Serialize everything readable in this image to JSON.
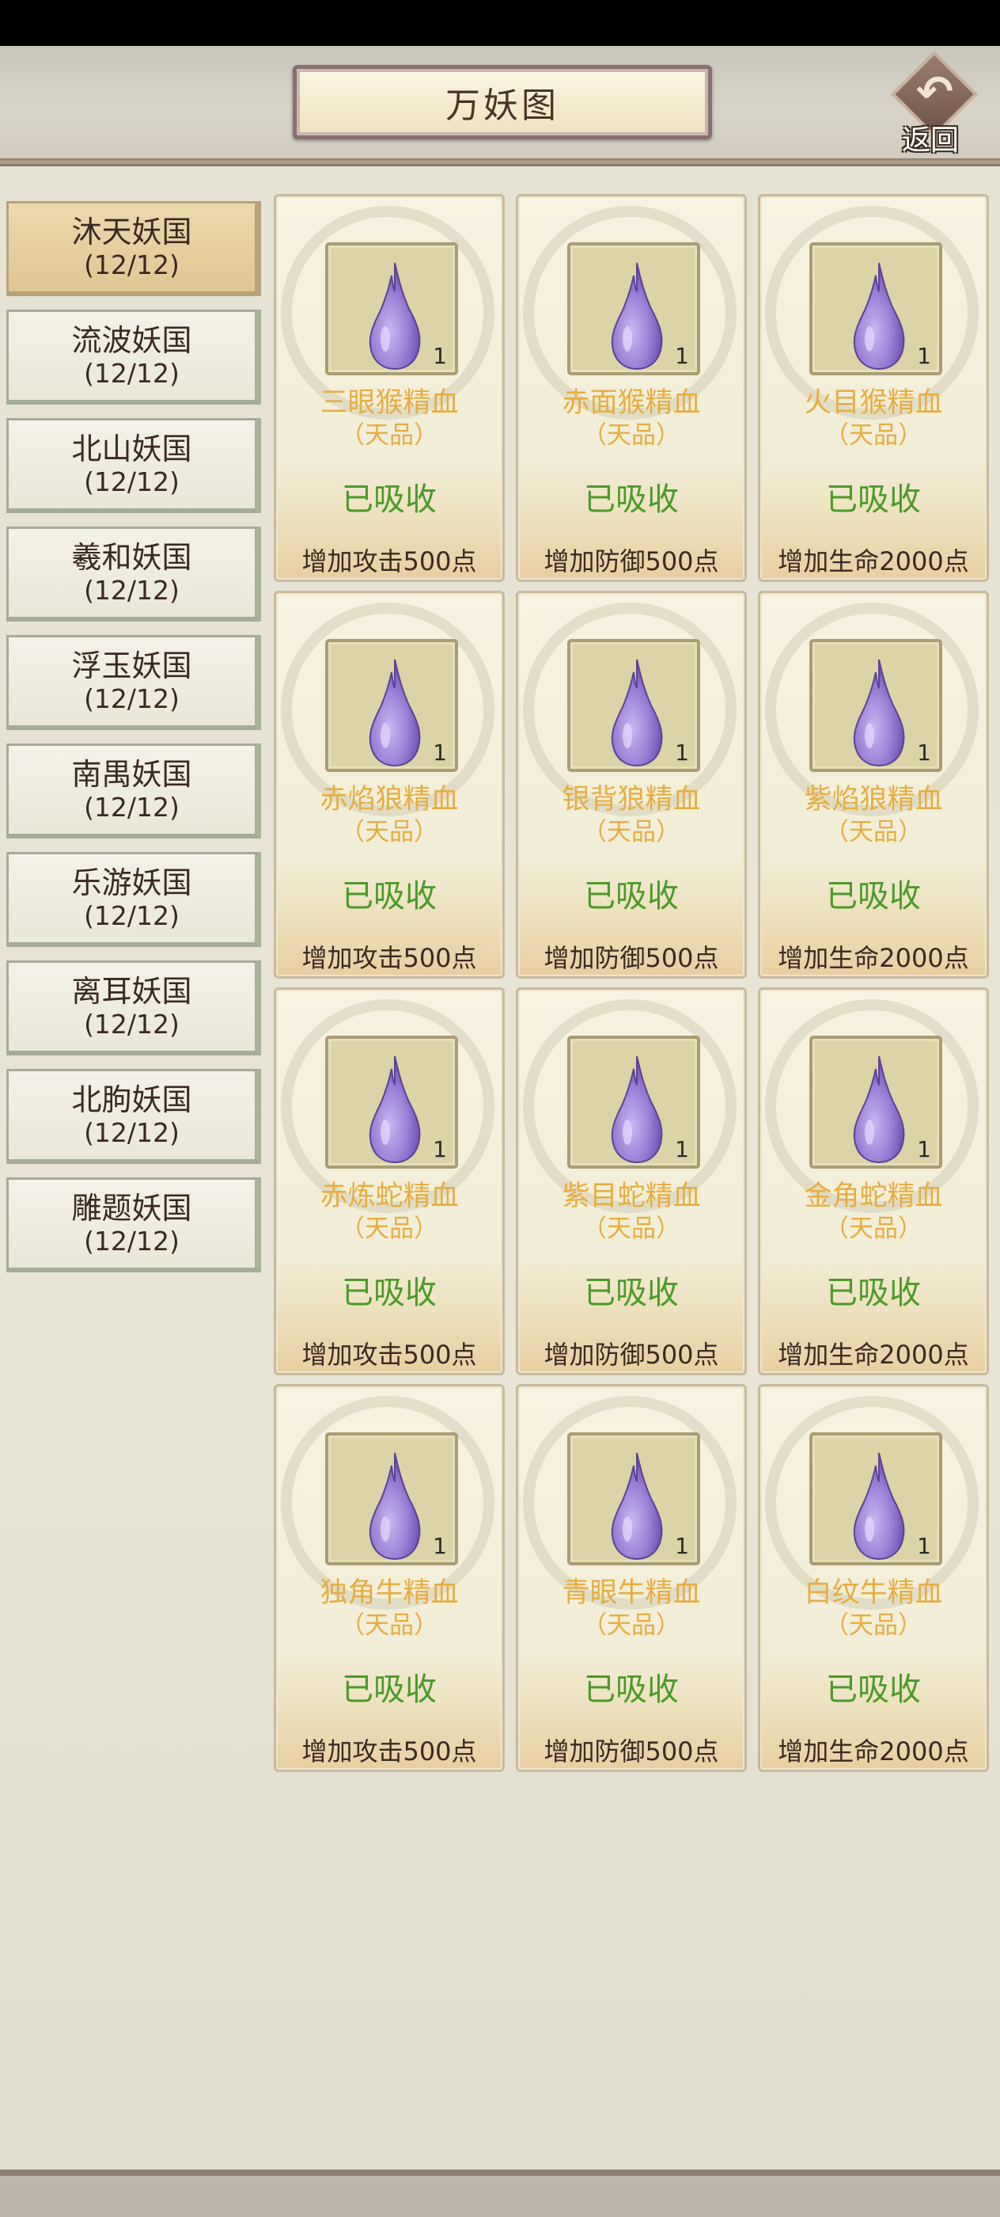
{
  "header": {
    "title": "万妖图",
    "back_label": "返回"
  },
  "nations": [
    {
      "name": "沐天妖国",
      "count": "(12/12)",
      "active": true
    },
    {
      "name": "流波妖国",
      "count": "(12/12)"
    },
    {
      "name": "北山妖国",
      "count": "(12/12)"
    },
    {
      "name": "羲和妖国",
      "count": "(12/12)"
    },
    {
      "name": "浮玉妖国",
      "count": "(12/12)"
    },
    {
      "name": "南禺妖国",
      "count": "(12/12)"
    },
    {
      "name": "乐游妖国",
      "count": "(12/12)"
    },
    {
      "name": "离耳妖国",
      "count": "(12/12)"
    },
    {
      "name": "北朐妖国",
      "count": "(12/12)"
    },
    {
      "name": "雕题妖国",
      "count": "(12/12)"
    }
  ],
  "items": [
    {
      "name": "三眼猴精血",
      "grade": "（天品）",
      "qty": "1",
      "status": "已吸收",
      "bonus": "增加攻击500点"
    },
    {
      "name": "赤面猴精血",
      "grade": "（天品）",
      "qty": "1",
      "status": "已吸收",
      "bonus": "增加防御500点"
    },
    {
      "name": "火目猴精血",
      "grade": "（天品）",
      "qty": "1",
      "status": "已吸收",
      "bonus": "增加生命2000点"
    },
    {
      "name": "赤焰狼精血",
      "grade": "（天品）",
      "qty": "1",
      "status": "已吸收",
      "bonus": "增加攻击500点"
    },
    {
      "name": "银背狼精血",
      "grade": "（天品）",
      "qty": "1",
      "status": "已吸收",
      "bonus": "增加防御500点"
    },
    {
      "name": "紫焰狼精血",
      "grade": "（天品）",
      "qty": "1",
      "status": "已吸收",
      "bonus": "增加生命2000点"
    },
    {
      "name": "赤炼蛇精血",
      "grade": "（天品）",
      "qty": "1",
      "status": "已吸收",
      "bonus": "增加攻击500点"
    },
    {
      "name": "紫目蛇精血",
      "grade": "（天品）",
      "qty": "1",
      "status": "已吸收",
      "bonus": "增加防御500点"
    },
    {
      "name": "金角蛇精血",
      "grade": "（天品）",
      "qty": "1",
      "status": "已吸收",
      "bonus": "增加生命2000点"
    },
    {
      "name": "独角牛精血",
      "grade": "（天品）",
      "qty": "1",
      "status": "已吸收",
      "bonus": "增加攻击500点"
    },
    {
      "name": "青眼牛精血",
      "grade": "（天品）",
      "qty": "1",
      "status": "已吸收",
      "bonus": "增加防御500点"
    },
    {
      "name": "白纹牛精血",
      "grade": "（天品）",
      "qty": "1",
      "status": "已吸收",
      "bonus": "增加生命2000点"
    }
  ],
  "icons": {
    "item_icon": "purple-blood-drop-icon",
    "back_icon": "back-arrow-icon"
  },
  "colors": {
    "item_name": "#e7ad42",
    "status": "#4b9a2a",
    "drop": "#9b7fd6"
  }
}
